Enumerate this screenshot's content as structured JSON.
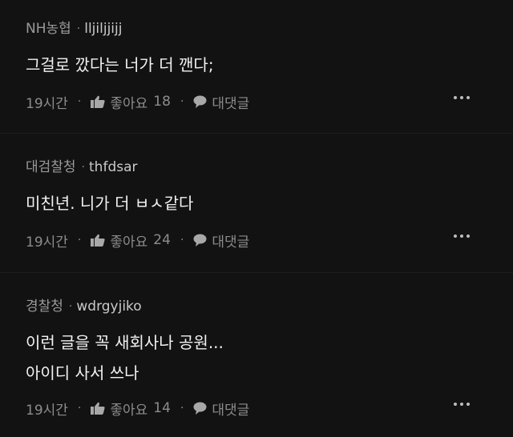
{
  "comments": [
    {
      "author": "NH농협",
      "username": "lljiljjijj",
      "lines": [
        "그걸로 깠다는 너가 더 깬다;"
      ],
      "time": "19시간",
      "like_label": "좋아요",
      "like_count": "18",
      "reply_label": "대댓글"
    },
    {
      "author": "대검찰청",
      "username": "thfdsar",
      "lines": [
        "미친년. 니가 더 ㅂㅅ같다"
      ],
      "time": "19시간",
      "like_label": "좋아요",
      "like_count": "24",
      "reply_label": "대댓글"
    },
    {
      "author": "경찰청",
      "username": "wdrgyjiko",
      "lines": [
        "이런 글을 꼭 새회사나 공원...",
        "아이디 사서 쓰나"
      ],
      "time": "19시간",
      "like_label": "좋아요",
      "like_count": "14",
      "reply_label": "대댓글"
    }
  ],
  "separator": "·",
  "icons": {
    "like": "thumbs-up-icon",
    "reply": "speech-bubble-icon",
    "more": "more-dots-icon"
  },
  "colors": {
    "background": "#121212",
    "author": "#9a9a9a",
    "body_text": "#f2f2f2",
    "muted": "#8c8c8c"
  }
}
